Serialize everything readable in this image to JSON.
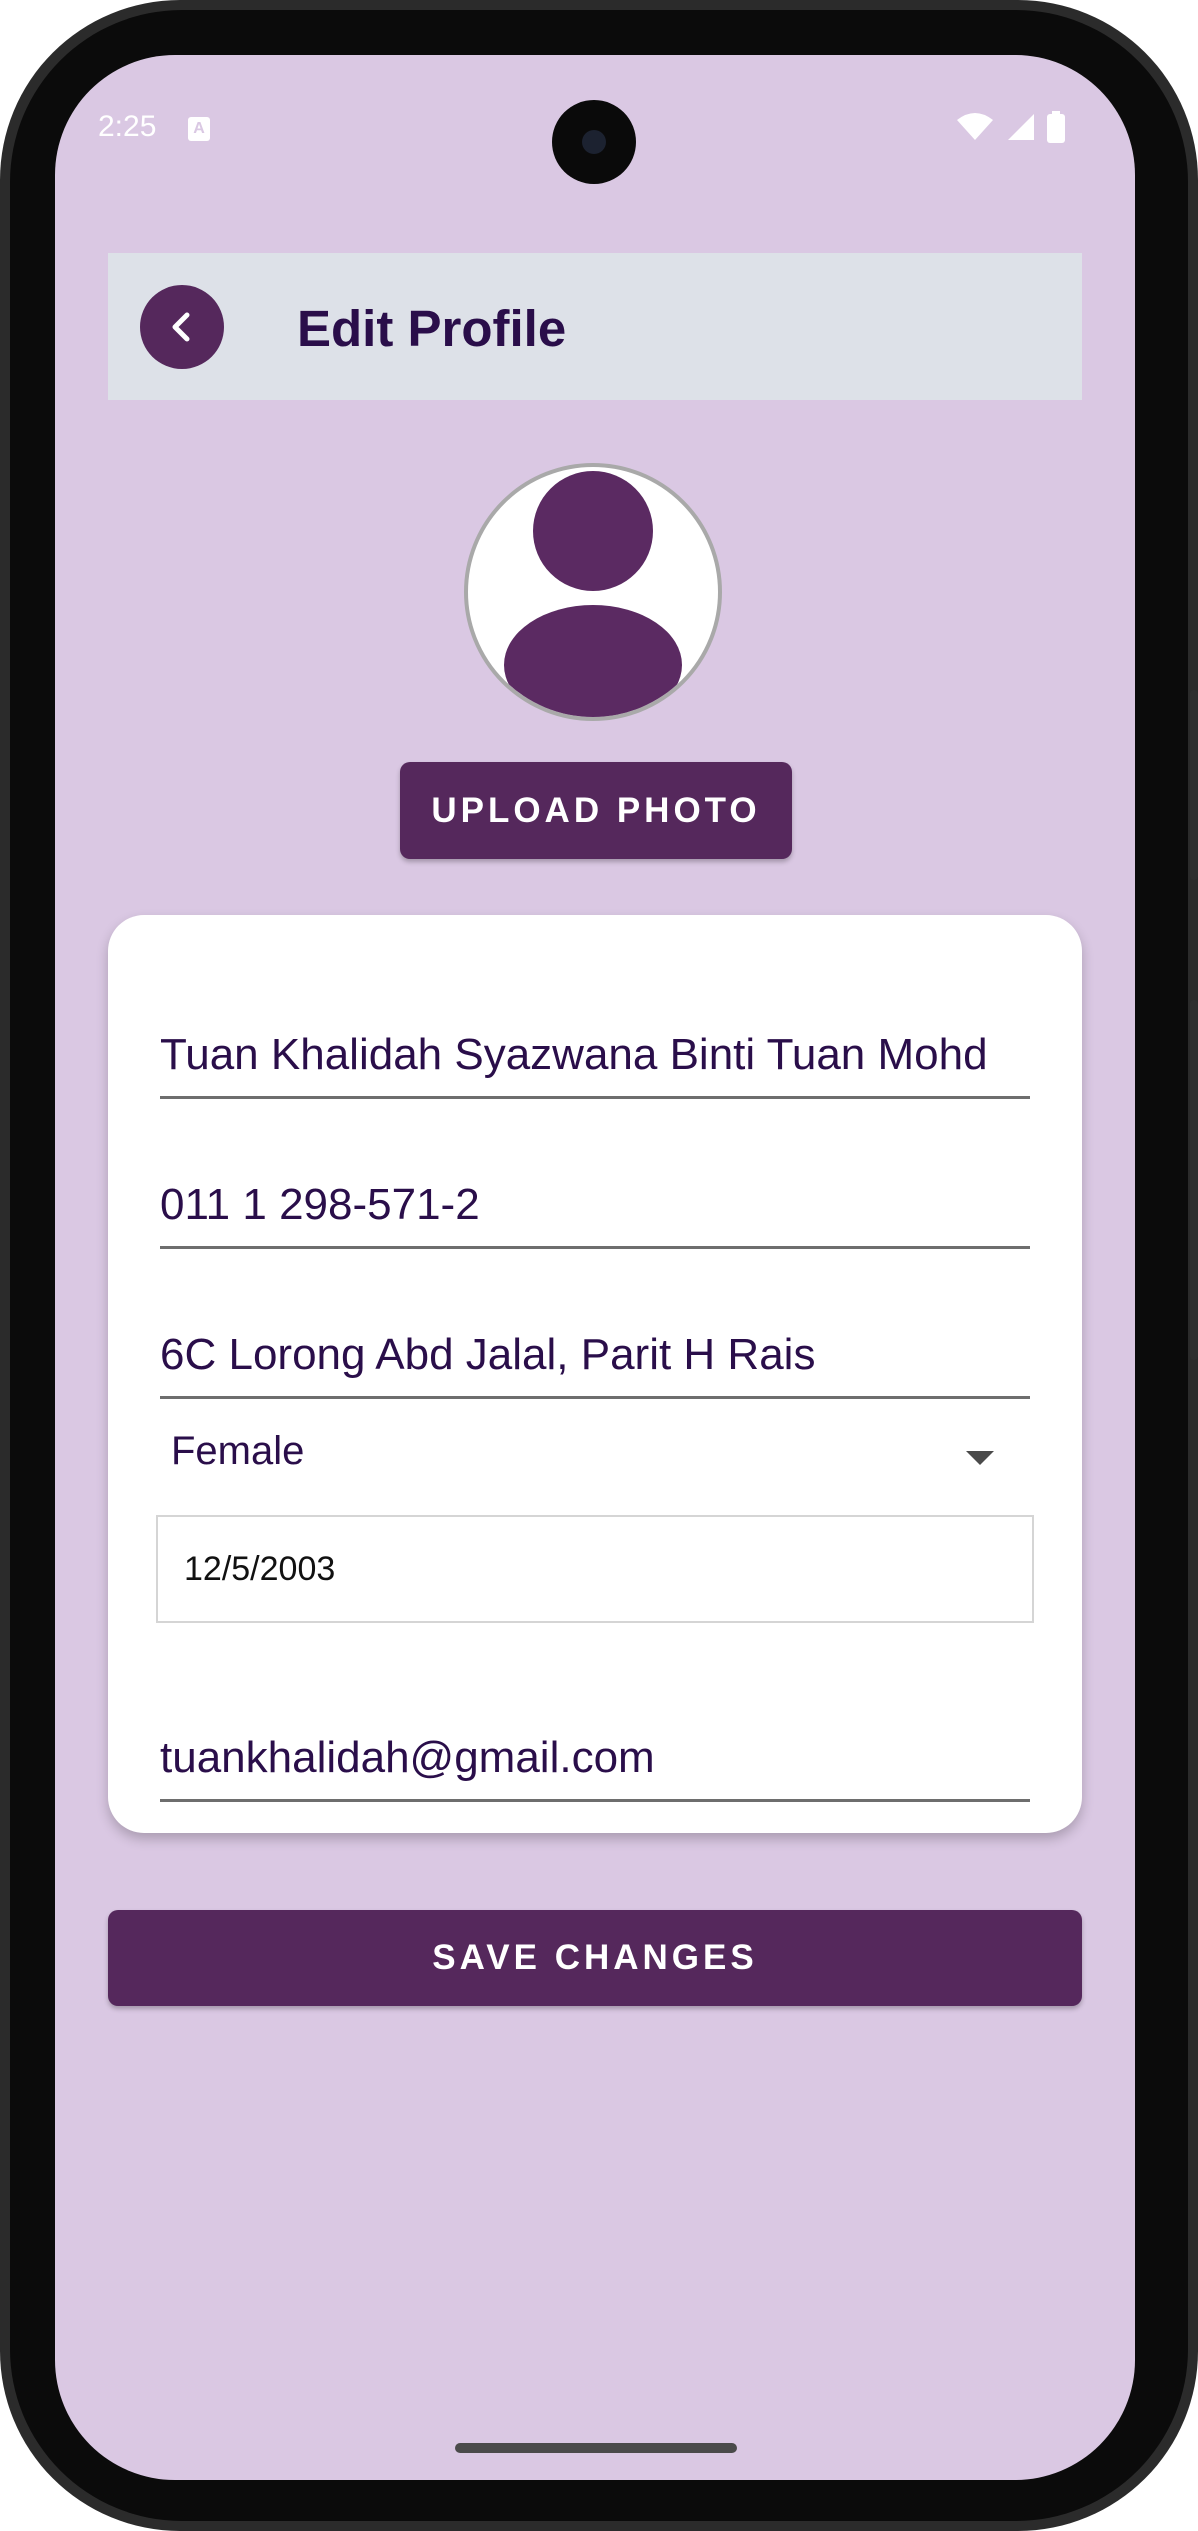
{
  "status_bar": {
    "time": "2:25",
    "indicator": "A",
    "icons": [
      "wifi-icon",
      "signal-icon",
      "battery-icon"
    ]
  },
  "header": {
    "title": "Edit Profile",
    "back_icon": "chevron-left-icon"
  },
  "profile": {
    "avatar_icon": "person-icon",
    "upload_label": "UPLOAD PHOTO"
  },
  "form": {
    "name": "Tuan Khalidah Syazwana Binti Tuan Mohd",
    "phone": "011 1 298-571-2",
    "address": "6C Lorong Abd Jalal, Parit H Rais",
    "gender": "Female",
    "birth_date": "12/5/2003",
    "email": "tuankhalidah@gmail.com"
  },
  "actions": {
    "save_label": "SAVE CHANGES"
  },
  "colors": {
    "background": "#dac8e3",
    "primary": "#55285c",
    "header_bar": "#dde1e8",
    "text": "#2a0e4a",
    "card": "#ffffff"
  }
}
